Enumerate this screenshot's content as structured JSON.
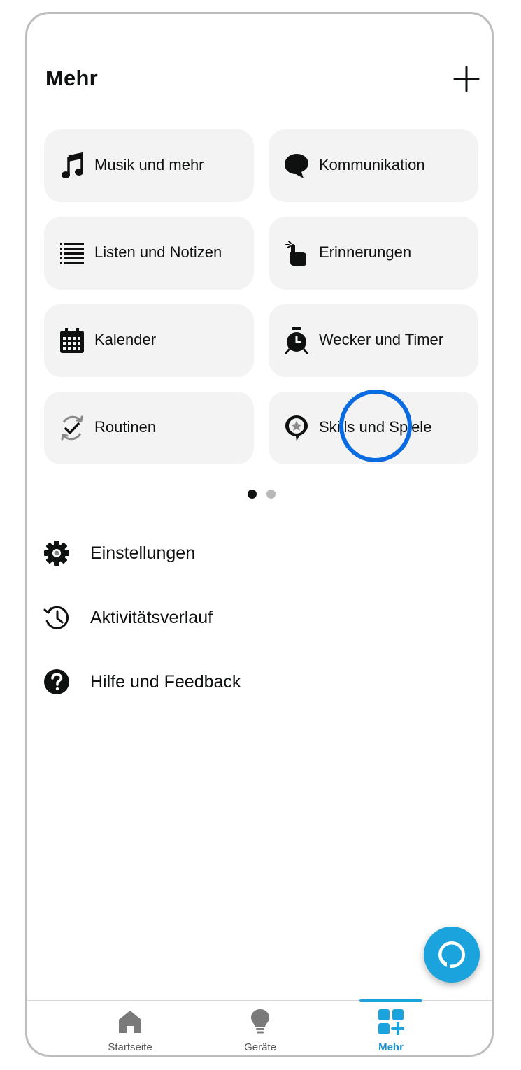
{
  "header": {
    "title": "Mehr",
    "add_icon": "plus-icon"
  },
  "tiles": [
    {
      "label": "Musik und mehr",
      "icon": "music-note-icon"
    },
    {
      "label": "Kommunikation",
      "icon": "speech-bubble-icon"
    },
    {
      "label": "Listen und Notizen",
      "icon": "list-icon"
    },
    {
      "label": "Erinnerungen",
      "icon": "reminder-hand-icon"
    },
    {
      "label": "Kalender",
      "icon": "calendar-icon"
    },
    {
      "label": "Wecker und Timer",
      "icon": "alarm-clock-icon"
    },
    {
      "label": "Routinen",
      "icon": "routine-check-icon"
    },
    {
      "label": "Skills und Spiele",
      "icon": "skills-star-icon"
    }
  ],
  "pager": {
    "pages": 2,
    "current": 1
  },
  "menu": [
    {
      "label": "Einstellungen",
      "icon": "gear-icon"
    },
    {
      "label": "Aktivitätsverlauf",
      "icon": "history-icon"
    },
    {
      "label": "Hilfe und Feedback",
      "icon": "help-icon"
    }
  ],
  "tabs": [
    {
      "label": "Startseite",
      "icon": "home-icon",
      "active": false
    },
    {
      "label": "Geräte",
      "icon": "lightbulb-icon",
      "active": false
    },
    {
      "label": "Mehr",
      "icon": "more-grid-icon",
      "active": true
    }
  ],
  "colors": {
    "accent": "#1aa3dd",
    "highlight_ring": "#0a6be0",
    "tile_bg": "#f3f3f3",
    "text": "#0f1111"
  }
}
